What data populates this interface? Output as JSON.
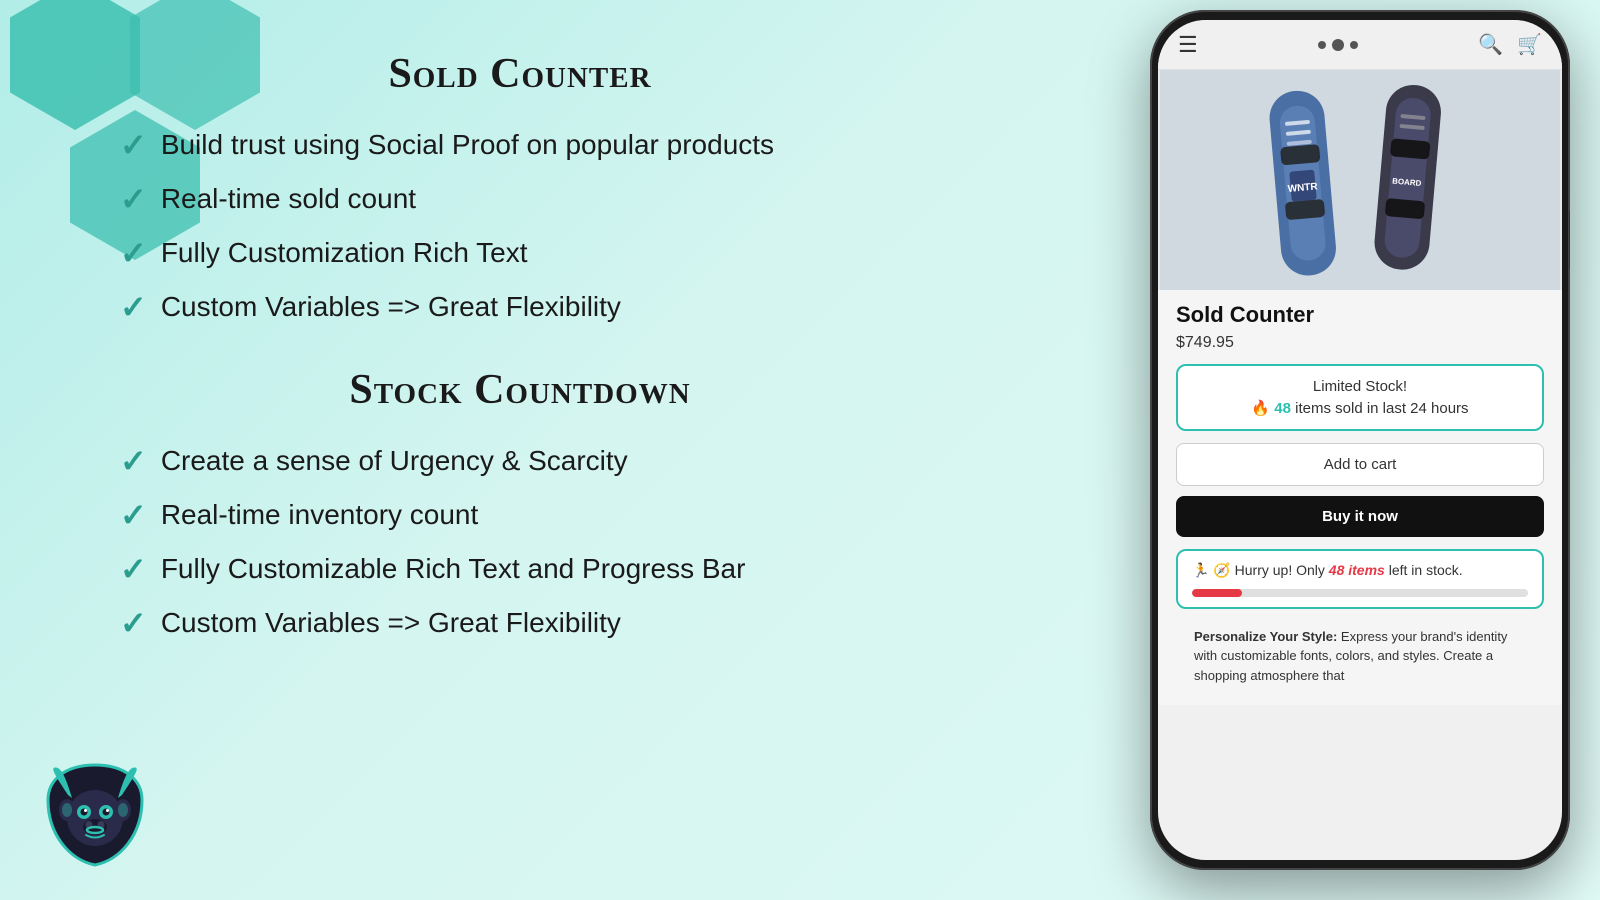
{
  "page": {
    "bg_color": "#c8f0eb"
  },
  "hexagons": {
    "color": "#3dbfb0"
  },
  "sold_counter": {
    "title": "Sold Counter",
    "features": [
      "Build trust using Social Proof on popular products",
      "Real-time sold count",
      "Fully Customization Rich Text",
      "Custom Variables => Great Flexibility"
    ]
  },
  "stock_countdown": {
    "title": "Stock Countdown",
    "features": [
      "Create a sense of Urgency & Scarcity",
      "Real-time inventory count",
      "Fully Customizable Rich Text and Progress Bar",
      "Custom Variables => Great Flexibility"
    ]
  },
  "phone": {
    "product_title": "Sold Counter",
    "product_price": "$749.95",
    "sold_counter_box": {
      "limited_label": "Limited Stock!",
      "sold_text_prefix": "🔥 ",
      "sold_count": "48",
      "sold_text_suffix": " items sold in last 24 hours"
    },
    "add_to_cart_label": "Add to cart",
    "buy_now_label": "Buy it now",
    "stock_countdown_box": {
      "text_prefix": "🏃 🧭 Hurry up! Only ",
      "items_count": "48 items",
      "text_suffix": " left in stock."
    },
    "bottom_text_bold": "Personalize Your Style:",
    "bottom_text_rest": " Express your brand's identity with customizable fonts, colors, and styles. Create a shopping atmosphere that"
  },
  "check_symbol": "✓",
  "nav": {
    "menu_symbol": "☰",
    "search_symbol": "🔍",
    "cart_symbol": "🛒"
  }
}
